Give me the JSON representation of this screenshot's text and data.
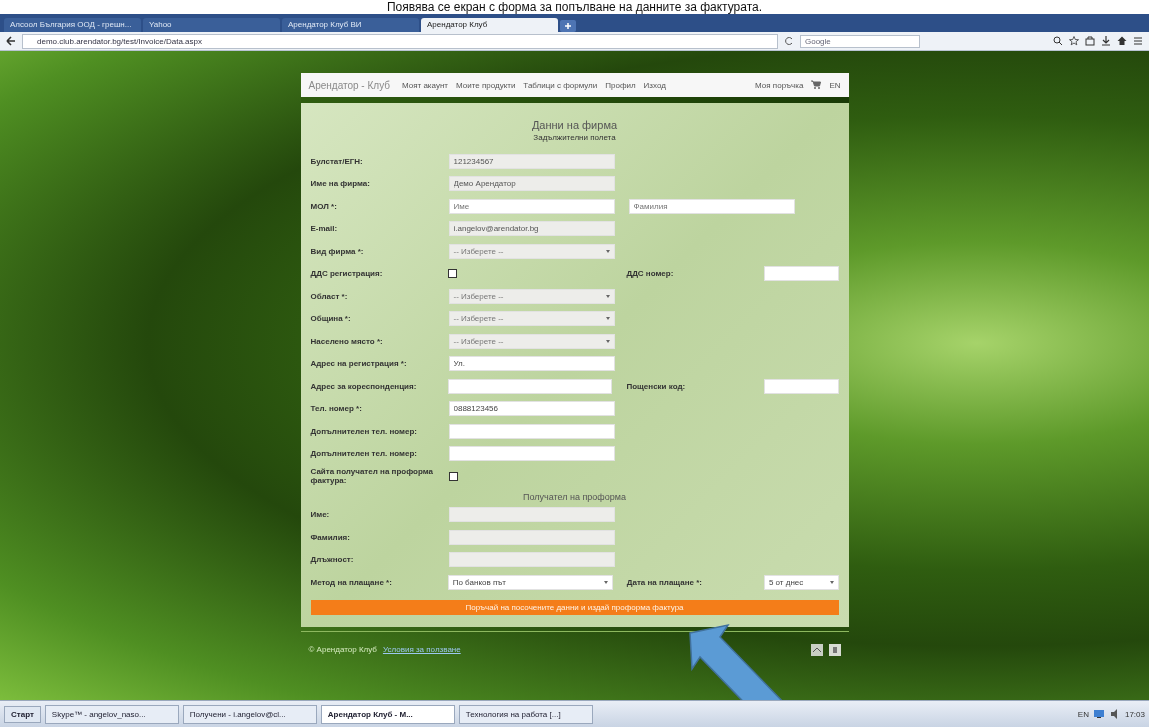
{
  "caption": "Появява се екран с форма за попълване на данните за фактурата.",
  "browser": {
    "tabs": [
      {
        "title": "Алсоол България ООД - грешн...",
        "selected": false
      },
      {
        "title": "Yahoo",
        "selected": false
      },
      {
        "title": "Арендатор Клуб ВИ",
        "selected": false
      },
      {
        "title": "Арендатор Клуб",
        "selected": true
      }
    ],
    "address": "demo.club.arendator.bg/test/Invoice/Data.aspx",
    "search_placeholder": "Google"
  },
  "site_nav": {
    "logo": "Арендатор - Клуб",
    "items": [
      "Моят акаунт",
      "Моите продукти",
      "Таблици с формули",
      "Профил",
      "Изход"
    ],
    "cart": "Моя поръчка",
    "lang": "EN"
  },
  "form": {
    "title": "Данни на фирма",
    "subtitle": "Задължителни полета",
    "rows": [
      {
        "kind": "input",
        "label": "Булстат/ЕГН:",
        "value": "121234567",
        "disabled": true
      },
      {
        "kind": "input",
        "label": "Име на фирма:",
        "value": "Демо Арендатор",
        "disabled": true
      },
      {
        "kind": "input",
        "label": "МОЛ *:",
        "placeholder": "Име",
        "disabled": false,
        "second": {
          "kind": "input",
          "placeholder": "Фамилия",
          "disabled": false
        }
      },
      {
        "kind": "input",
        "label": "E-mail:",
        "value": "i.angelov@arendator.bg",
        "disabled": true
      },
      {
        "kind": "select",
        "label": "Вид фирма *:",
        "value": "-- Изберете --",
        "disabled": true
      },
      {
        "kind": "checkbox",
        "label": "ДДС регистрация:",
        "checked": false,
        "second": {
          "kind": "input",
          "label": "ДДС номер:",
          "disabled": false
        }
      },
      {
        "kind": "select",
        "label": "Област *:",
        "value": "-- Изберете --",
        "disabled": true
      },
      {
        "kind": "select",
        "label": "Община *:",
        "value": "-- Изберете --",
        "disabled": true
      },
      {
        "kind": "select",
        "label": "Населено място *:",
        "value": "-- Изберете --",
        "disabled": true
      },
      {
        "kind": "input",
        "label": "Адрес на регистрация *:",
        "value": "Ул.",
        "disabled": false
      },
      {
        "kind": "input",
        "label": "Адрес за кореспонденция:",
        "disabled": false,
        "second": {
          "kind": "input",
          "label": "Пощенски код:",
          "disabled": false
        }
      },
      {
        "kind": "input",
        "label": "Тел. номер *:",
        "value": "0888123456",
        "disabled": false
      },
      {
        "kind": "input",
        "label": "Допълнителен тел. номер:",
        "disabled": false
      },
      {
        "kind": "input",
        "label": "Допълнителен тел. номер:",
        "disabled": false
      },
      {
        "kind": "checkbox",
        "label": "Сайта получател на проформа фактура:",
        "checked": false
      }
    ],
    "section_title": "Получател на проформа",
    "recipient_rows": [
      {
        "kind": "input",
        "label": "Име:",
        "disabled": true
      },
      {
        "kind": "input",
        "label": "Фамилия:",
        "disabled": true
      },
      {
        "kind": "input",
        "label": "Длъжност:",
        "disabled": true
      },
      {
        "kind": "select",
        "label": "Метод на плащане *:",
        "value": "По банков път",
        "disabled": false,
        "second": {
          "kind": "select",
          "label": "Дата на плащане *:",
          "value": "5 от днес",
          "disabled": false
        }
      }
    ],
    "submit": "Поръчай на посочените данни и издай проформа фактура"
  },
  "footer": {
    "copyright": "© Арендатор Клуб",
    "link": "Условия за ползване"
  },
  "taskbar": {
    "start": "Старт",
    "items": [
      {
        "title": "Skype™ - angelov_naso...",
        "selected": false
      },
      {
        "title": "Получени - i.angelov@cl...",
        "selected": false
      },
      {
        "title": "Арендатор Клуб - M...",
        "selected": true
      },
      {
        "title": "Технология на работа [...]",
        "selected": false
      }
    ],
    "lang": "EN",
    "clock": "17:03"
  }
}
